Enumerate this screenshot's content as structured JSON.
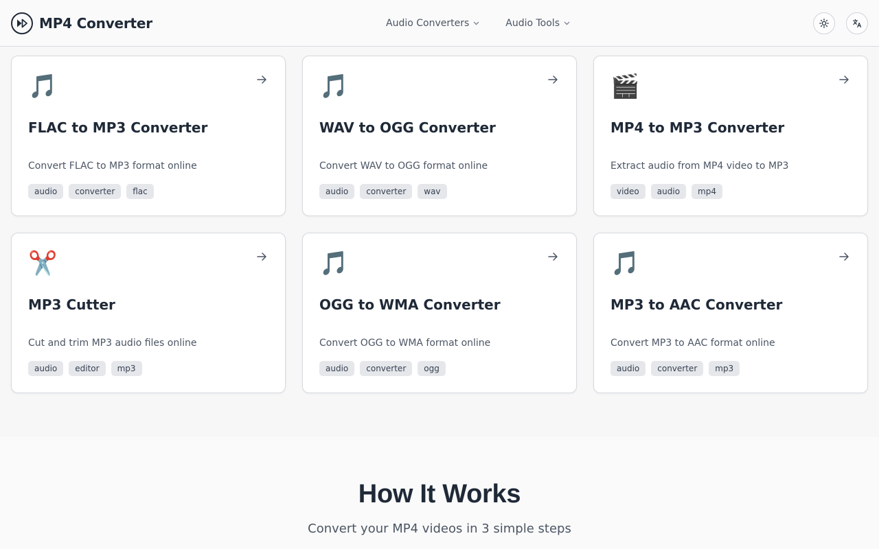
{
  "header": {
    "brand": "MP4 Converter",
    "nav": [
      {
        "label": "Audio Converters"
      },
      {
        "label": "Audio Tools"
      }
    ]
  },
  "cards": [
    {
      "emoji": "🎵",
      "title": "FLAC to MP3 Converter",
      "description": "Convert FLAC to MP3 format online",
      "tags": [
        "audio",
        "converter",
        "flac"
      ]
    },
    {
      "emoji": "🎵",
      "title": "WAV to OGG Converter",
      "description": "Convert WAV to OGG format online",
      "tags": [
        "audio",
        "converter",
        "wav"
      ]
    },
    {
      "emoji": "🎬",
      "title": "MP4 to MP3 Converter",
      "description": "Extract audio from MP4 video to MP3",
      "tags": [
        "video",
        "audio",
        "mp4"
      ]
    },
    {
      "emoji": "✂️",
      "title": "MP3 Cutter",
      "description": "Cut and trim MP3 audio files online",
      "tags": [
        "audio",
        "editor",
        "mp3"
      ]
    },
    {
      "emoji": "🎵",
      "title": "OGG to WMA Converter",
      "description": "Convert OGG to WMA format online",
      "tags": [
        "audio",
        "converter",
        "ogg"
      ]
    },
    {
      "emoji": "🎵",
      "title": "MP3 to AAC Converter",
      "description": "Convert MP3 to AAC format online",
      "tags": [
        "audio",
        "converter",
        "mp3"
      ]
    }
  ],
  "how_it_works": {
    "title": "How It Works",
    "subtitle": "Convert your MP4 videos in 3 simple steps"
  },
  "icons": {
    "brand": "play-circle-icon",
    "nav_chevron": "chevron-down-icon",
    "theme": "sun-icon",
    "language": "translate-icon",
    "card_link": "arrow-right-icon"
  },
  "colors": {
    "text": "#1f2937",
    "muted": "#4b5563",
    "tag_bg": "#e5e7eb",
    "border": "#d6d9de",
    "page_bg": "#f7f7f7"
  }
}
